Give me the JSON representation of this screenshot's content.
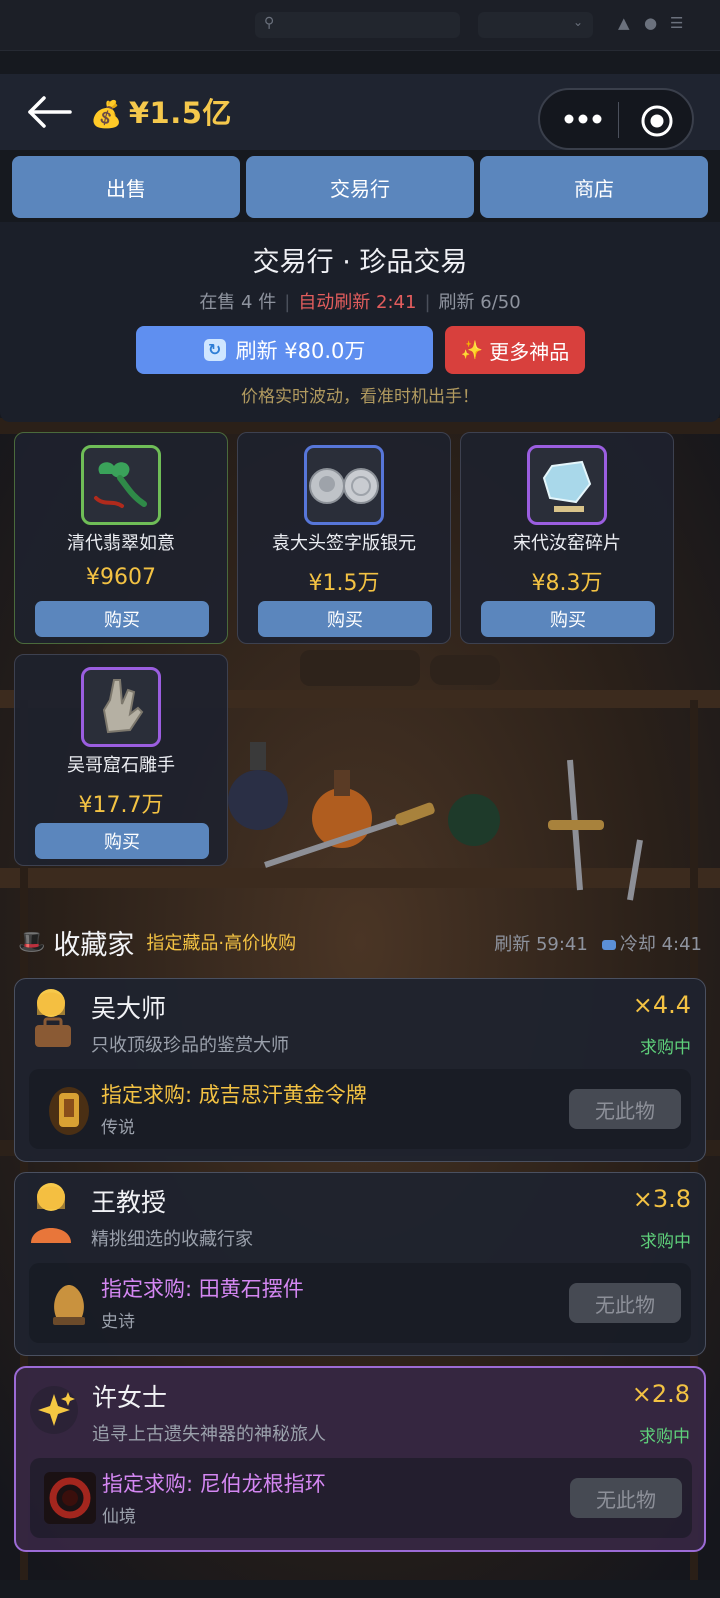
{
  "header": {
    "money_icon": "money-bag-icon",
    "money": "¥1.5亿"
  },
  "tabs": [
    {
      "label": "出售"
    },
    {
      "label": "交易行"
    },
    {
      "label": "商店"
    }
  ],
  "trade": {
    "title": "交易行 · 珍品交易",
    "on_sale": "在售 4 件",
    "auto_refresh": "自动刷新 2:41",
    "refresh_count": "刷新 6/50",
    "refresh_button": "刷新 ¥80.0万",
    "more_button": "更多神品",
    "hint": "价格实时波动，看准时机出手！"
  },
  "items": [
    {
      "name": "清代翡翠如意",
      "price": "¥9607",
      "buy": "购买",
      "rarity_color": "#6fbd57"
    },
    {
      "name": "袁大头签字版银元",
      "price": "¥1.5万",
      "buy": "购买",
      "rarity_color": "#5776d9"
    },
    {
      "name": "宋代汝窑碎片",
      "price": "¥8.3万",
      "buy": "购买",
      "rarity_color": "#9b5ee0"
    },
    {
      "name": "吴哥窟石雕手",
      "price": "¥17.7万",
      "buy": "购买",
      "rarity_color": "#9b5ee0"
    }
  ],
  "collectors_header": {
    "title": "收藏家",
    "subtitle": "指定藏品·高价收购",
    "refresh": "刷新 59:41",
    "cooldown": "冷却 4:41"
  },
  "collectors": [
    {
      "name": "吴大师",
      "desc": "只收顶级珍品的鉴赏大师",
      "multiplier": "×4.4",
      "status": "求购中",
      "request": "指定求购: 成吉思汗黄金令牌",
      "rarity": "传说",
      "action": "无此物"
    },
    {
      "name": "王教授",
      "desc": "精挑细选的收藏行家",
      "multiplier": "×3.8",
      "status": "求购中",
      "request": "指定求购: 田黄石摆件",
      "rarity": "史诗",
      "action": "无此物"
    },
    {
      "name": "许女士",
      "desc": "追寻上古遗失神器的神秘旅人",
      "multiplier": "×2.8",
      "status": "求购中",
      "request": "指定求购: 尼伯龙根指环",
      "rarity": "仙境",
      "action": "无此物"
    }
  ],
  "colors": {
    "accent_blue": "#5b86bd",
    "gold": "#f3c243",
    "status_green": "#5ed07a",
    "danger_red": "#d8403d"
  }
}
